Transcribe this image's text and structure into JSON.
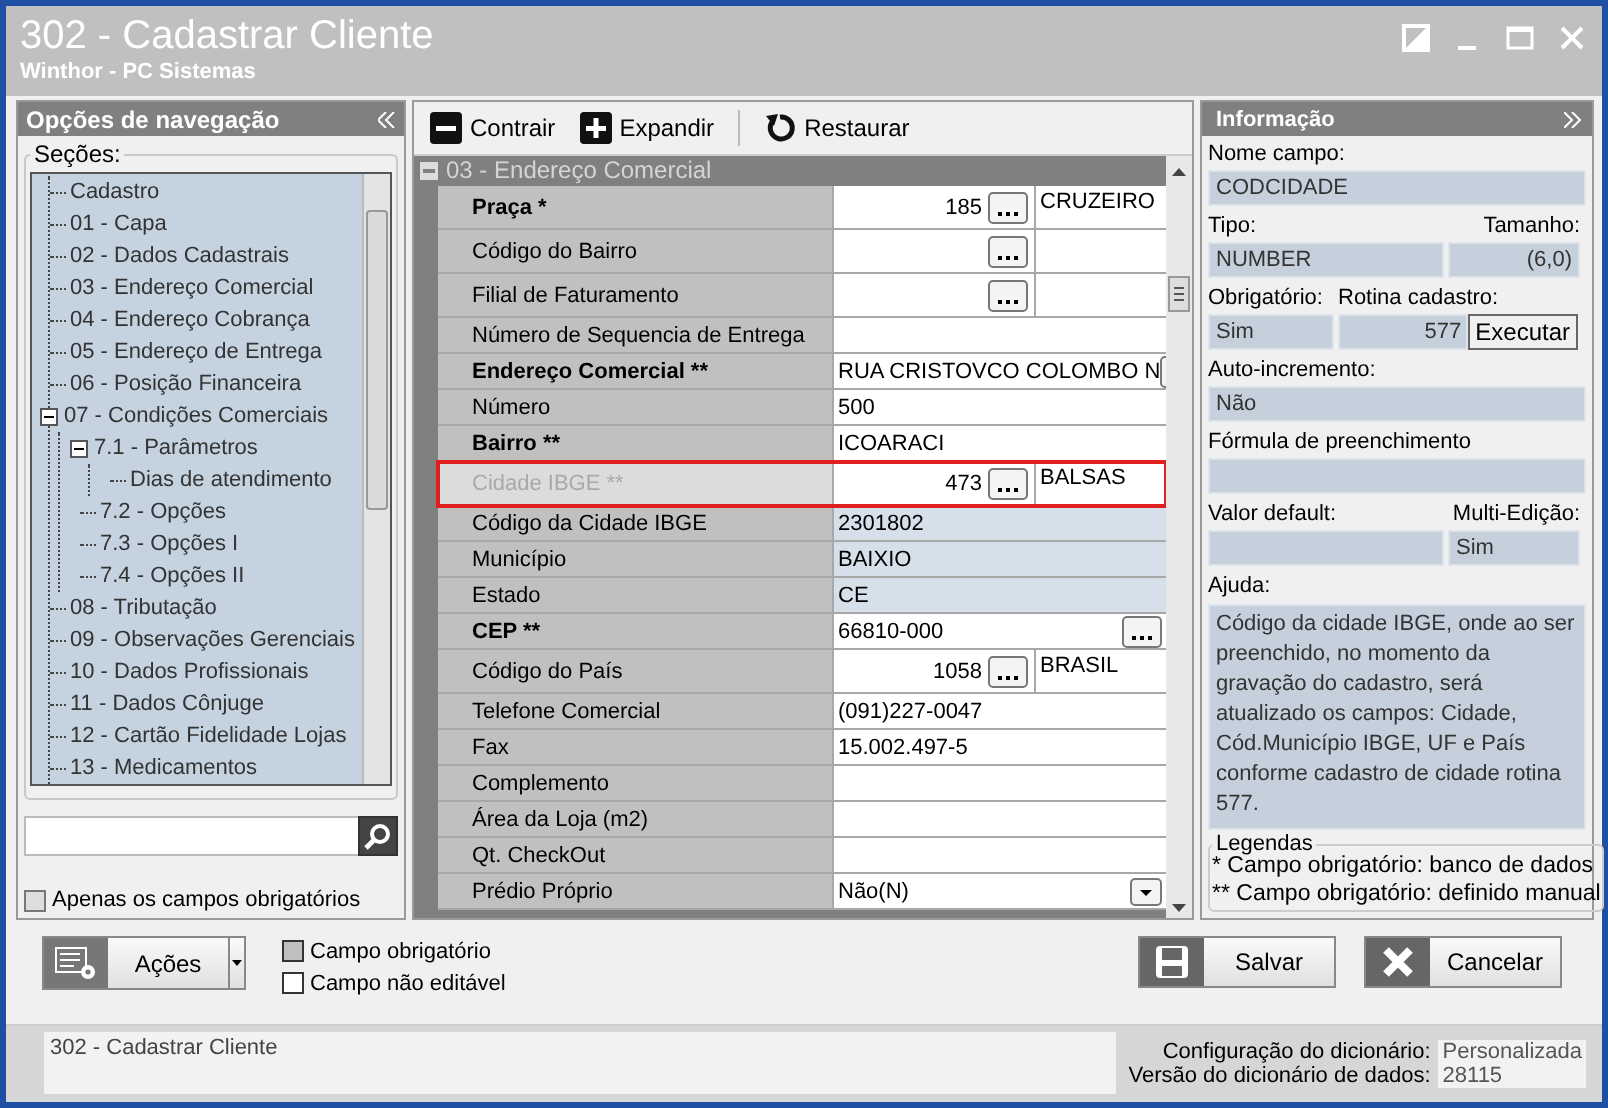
{
  "window": {
    "title": "302 - Cadastrar Cliente",
    "subtitle": "Winthor - PC Sistemas"
  },
  "navigation": {
    "title": "Opções de navegação",
    "group_label": "Seções:",
    "tree": [
      {
        "label": "Cadastro"
      },
      {
        "label": "01 - Capa"
      },
      {
        "label": "02 - Dados Cadastrais"
      },
      {
        "label": "03 - Endereço Comercial"
      },
      {
        "label": "04 - Endereço Cobrança"
      },
      {
        "label": "05 - Endereço de Entrega"
      },
      {
        "label": "06 - Posição Financeira"
      },
      {
        "label": "07 - Condições Comerciais",
        "expanded": true,
        "children": [
          {
            "label": "7.1 - Parâmetros",
            "expanded": true,
            "children": [
              {
                "label": "Dias de atendimento"
              }
            ]
          },
          {
            "label": "7.2 - Opções"
          },
          {
            "label": "7.3 - Opções I"
          },
          {
            "label": "7.4 - Opções II"
          }
        ]
      },
      {
        "label": "08 - Tributação"
      },
      {
        "label": "09 - Observações Gerenciais"
      },
      {
        "label": "10 - Dados Profissionais"
      },
      {
        "label": "11 - Dados Cônjuge"
      },
      {
        "label": "12 - Cartão Fidelidade Lojas"
      },
      {
        "label": "13 - Medicamentos"
      }
    ],
    "checkbox": {
      "label": "Apenas os campos obrigatórios",
      "checked": false
    }
  },
  "toolbar": [
    {
      "label": "Contrair",
      "kind": "collapse"
    },
    {
      "label": "Expandir",
      "kind": "expand"
    },
    {
      "label": "Restaurar",
      "kind": "restore"
    }
  ],
  "section": {
    "title": "03 - Endereço Comercial",
    "expanded": true,
    "rows": [
      {
        "label": "Praça *",
        "required": true,
        "disabled": false,
        "selected": false,
        "kind": "lookup",
        "code": "185",
        "description": "CRUZEIRO"
      },
      {
        "label": "Código do Bairro",
        "required": false,
        "disabled": false,
        "selected": false,
        "kind": "lookup"
      },
      {
        "label": "Filial de Faturamento",
        "required": false,
        "disabled": false,
        "selected": false,
        "kind": "lookup"
      },
      {
        "label": "Número de Sequencia de Entrega",
        "required": false,
        "disabled": false,
        "selected": false,
        "kind": "text"
      },
      {
        "label": "Endereço Comercial **",
        "required": true,
        "disabled": false,
        "selected": false,
        "kind": "text_button",
        "value": "RUA CRISTOVCO COLOMBO N"
      },
      {
        "label": "Número",
        "required": false,
        "disabled": false,
        "selected": false,
        "kind": "text",
        "value": "500"
      },
      {
        "label": "Bairro **",
        "required": true,
        "disabled": false,
        "selected": false,
        "kind": "text",
        "value": "ICOARACI"
      },
      {
        "label": "Cidade IBGE **",
        "required": false,
        "disabled": true,
        "selected": true,
        "kind": "lookup",
        "code": "473",
        "description": "BALSAS"
      },
      {
        "label": "Código da Cidade IBGE",
        "required": false,
        "disabled": false,
        "selected": false,
        "kind": "readonly",
        "value": "2301802"
      },
      {
        "label": "Município",
        "required": false,
        "disabled": false,
        "selected": false,
        "kind": "readonly",
        "value": "BAIXIO"
      },
      {
        "label": "Estado",
        "required": false,
        "disabled": false,
        "selected": false,
        "kind": "readonly",
        "value": "CE"
      },
      {
        "label": "CEP **",
        "required": true,
        "disabled": false,
        "selected": false,
        "kind": "text_button",
        "value": "66810-000"
      },
      {
        "label": "Código do País",
        "required": false,
        "disabled": false,
        "selected": false,
        "kind": "lookup",
        "code": "1058",
        "description": "BRASIL"
      },
      {
        "label": "Telefone Comercial",
        "required": false,
        "disabled": false,
        "selected": false,
        "kind": "text",
        "value": "(091)227-0047"
      },
      {
        "label": "Fax",
        "required": false,
        "disabled": false,
        "selected": false,
        "kind": "text",
        "value": "15.002.497-5"
      },
      {
        "label": "Complemento",
        "required": false,
        "disabled": false,
        "selected": false,
        "kind": "text"
      },
      {
        "label": "Área da Loja (m2)",
        "required": false,
        "disabled": false,
        "selected": false,
        "kind": "text"
      },
      {
        "label": "Qt. CheckOut",
        "required": false,
        "disabled": false,
        "selected": false,
        "kind": "text"
      },
      {
        "label": "Prédio Próprio",
        "required": false,
        "disabled": false,
        "selected": false,
        "kind": "dropdown",
        "value": "Não(N)"
      }
    ]
  },
  "info": {
    "title": "Informação",
    "rows": [
      [
        {
          "label": "Nome campo:",
          "value": "CODCIDADE"
        }
      ],
      [
        {
          "label": "Tipo:",
          "value": "NUMBER"
        },
        {
          "label": "Tamanho:",
          "value": "(6,0)",
          "kind": "number"
        }
      ],
      [
        {
          "label": "Obrigatório:",
          "value": "Sim"
        },
        {
          "label": "Rotina cadastro:",
          "value": "577",
          "kind": "number",
          "action": "Executar"
        }
      ],
      [
        {
          "label": "Auto-incremento:",
          "value": "Não"
        }
      ],
      [
        {
          "label": "Fórmula de preenchimento"
        }
      ],
      [
        {
          "label": "Valor default:"
        },
        {
          "label": "Multi-Edição:",
          "value": "Sim"
        }
      ]
    ],
    "help_label": "Ajuda:",
    "help_text": "Código da cidade IBGE, onde ao ser preenchido, no momento da gravação do cadastro, será atualizado os campos: Cidade, Cód.Município IBGE, UF e País conforme cadastro de cidade rotina 577.",
    "legend": {
      "title": "Legendas",
      "items": [
        "* Campo obrigatório: banco de dados",
        "** Campo obrigatório: definido manual"
      ]
    }
  },
  "actions_button": "Ações",
  "legend_colors": [
    {
      "label": "Campo obrigatório",
      "color": "#c0c0c0"
    },
    {
      "label": "Campo não editável",
      "color": "#ffffff"
    }
  ],
  "buttons": [
    {
      "label": "Salvar",
      "kind": "save"
    },
    {
      "label": "Cancelar",
      "kind": "cancel"
    }
  ],
  "status_bar": {
    "text": "302 - Cadastrar Cliente",
    "items": [
      {
        "label": "Configuração do dicionário:",
        "value": "Personalizada"
      },
      {
        "label": "Versão do dicionário de dados:",
        "value": "28115"
      }
    ]
  }
}
